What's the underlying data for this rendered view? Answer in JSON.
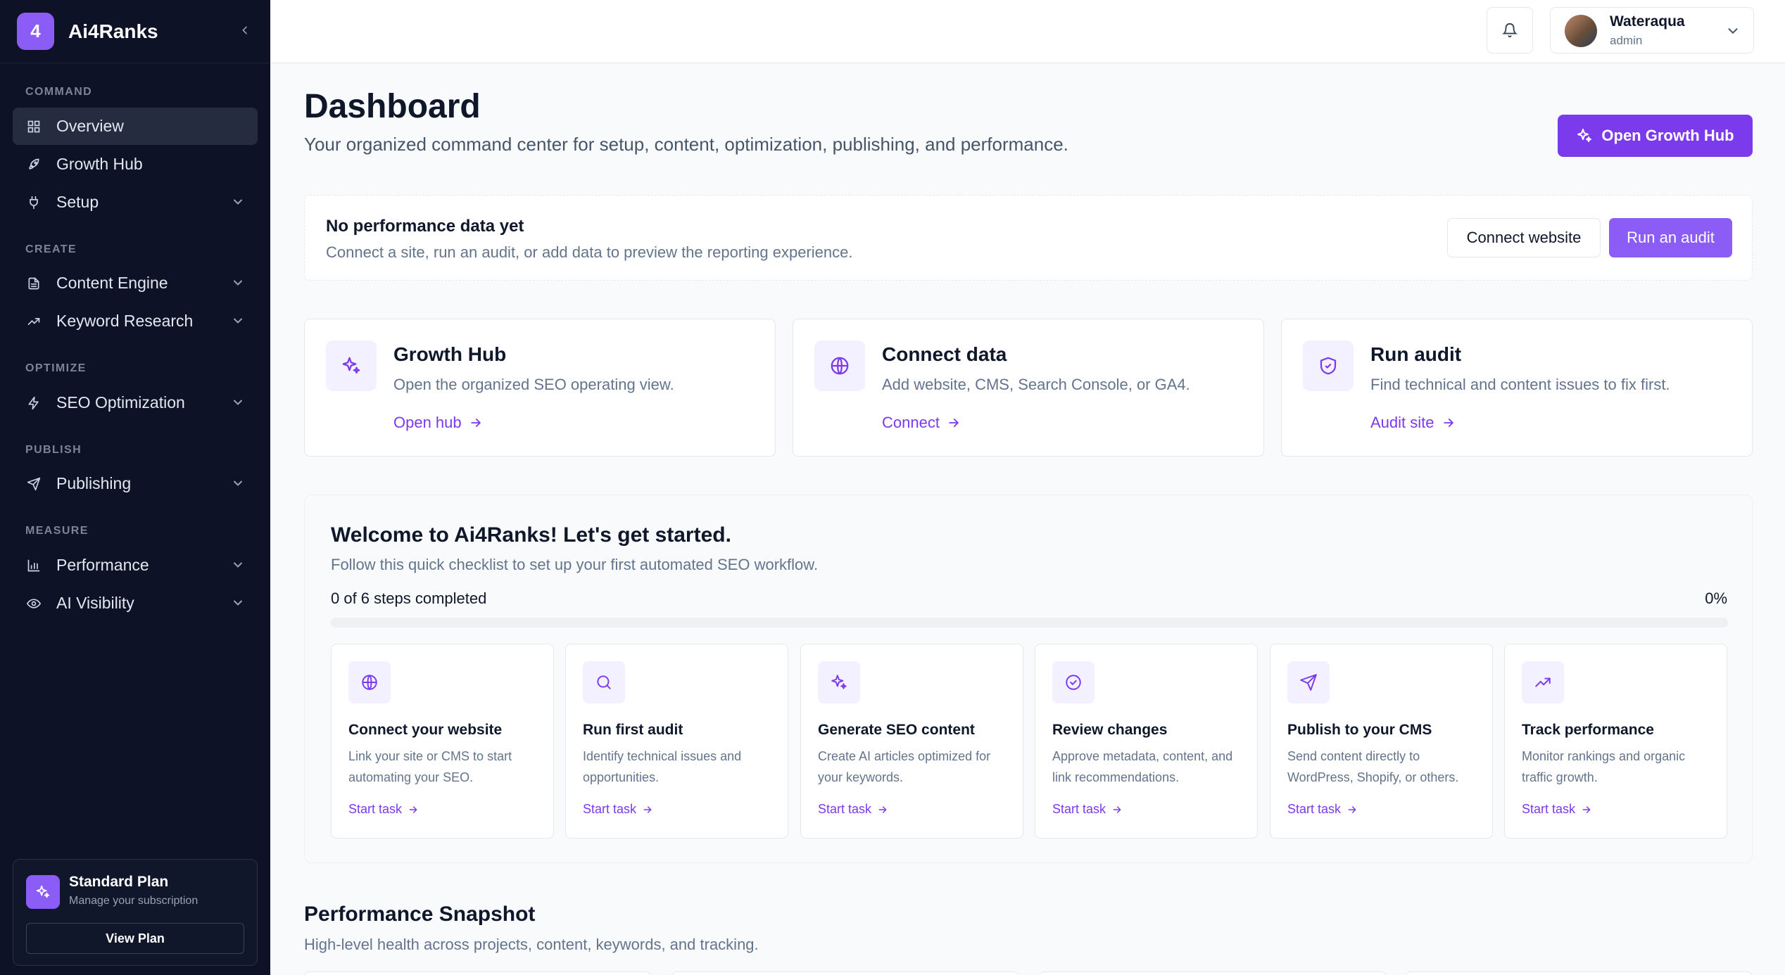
{
  "sidebar": {
    "brand": "Ai4Ranks",
    "brand_initial": "4",
    "sections": {
      "command": "COMMAND",
      "create": "CREATE",
      "optimize": "OPTIMIZE",
      "publish": "PUBLISH",
      "measure": "MEASURE"
    },
    "items": {
      "overview": "Overview",
      "growth_hub": "Growth Hub",
      "setup": "Setup",
      "content_engine": "Content Engine",
      "keyword_research": "Keyword Research",
      "seo_optimization": "SEO Optimization",
      "publishing": "Publishing",
      "performance": "Performance",
      "ai_visibility": "AI Visibility"
    },
    "plan": {
      "title": "Standard Plan",
      "subtitle": "Manage your subscription",
      "button": "View Plan"
    }
  },
  "topbar": {
    "user_name": "Wateraqua",
    "user_role": "admin"
  },
  "header": {
    "title": "Dashboard",
    "subtitle": "Your organized command center for setup, content, optimization, publishing, and performance.",
    "primary_button": "Open Growth Hub"
  },
  "banner": {
    "title": "No performance data yet",
    "subtitle": "Connect a site, run an audit, or add data to preview the reporting experience.",
    "connect_button": "Connect website",
    "audit_button": "Run an audit"
  },
  "quick_cards": [
    {
      "title": "Growth Hub",
      "desc": "Open the organized SEO operating view.",
      "link": "Open hub",
      "icon": "sparkles-icon"
    },
    {
      "title": "Connect data",
      "desc": "Add website, CMS, Search Console, or GA4.",
      "link": "Connect",
      "icon": "globe-icon"
    },
    {
      "title": "Run audit",
      "desc": "Find technical and content issues to fix first.",
      "link": "Audit site",
      "icon": "shield-check-icon"
    }
  ],
  "welcome": {
    "title": "Welcome to Ai4Ranks! Let's get started.",
    "subtitle": "Follow this quick checklist to set up your first automated SEO workflow.",
    "steps_text": "0 of 6 steps completed",
    "percent_text": "0%",
    "progress": 0,
    "tasks": [
      {
        "title": "Connect your website",
        "desc": "Link your site or CMS to start automating your SEO.",
        "link": "Start task",
        "icon": "globe-icon"
      },
      {
        "title": "Run first audit",
        "desc": "Identify technical issues and opportunities.",
        "link": "Start task",
        "icon": "search-icon"
      },
      {
        "title": "Generate SEO content",
        "desc": "Create AI articles optimized for your keywords.",
        "link": "Start task",
        "icon": "sparkles-icon"
      },
      {
        "title": "Review changes",
        "desc": "Approve metadata, content, and link recommendations.",
        "link": "Start task",
        "icon": "check-circle-icon"
      },
      {
        "title": "Publish to your CMS",
        "desc": "Send content directly to WordPress, Shopify, or others.",
        "link": "Start task",
        "icon": "send-icon"
      },
      {
        "title": "Track performance",
        "desc": "Monitor rankings and organic traffic growth.",
        "link": "Start task",
        "icon": "trending-up-icon"
      }
    ]
  },
  "snapshot": {
    "title": "Performance Snapshot",
    "subtitle": "High-level health across projects, content, keywords, and tracking."
  },
  "colors": {
    "accent": "#7c3aed",
    "accent_light": "#8b5cf6",
    "sidebar_bg": "#0d1226"
  }
}
